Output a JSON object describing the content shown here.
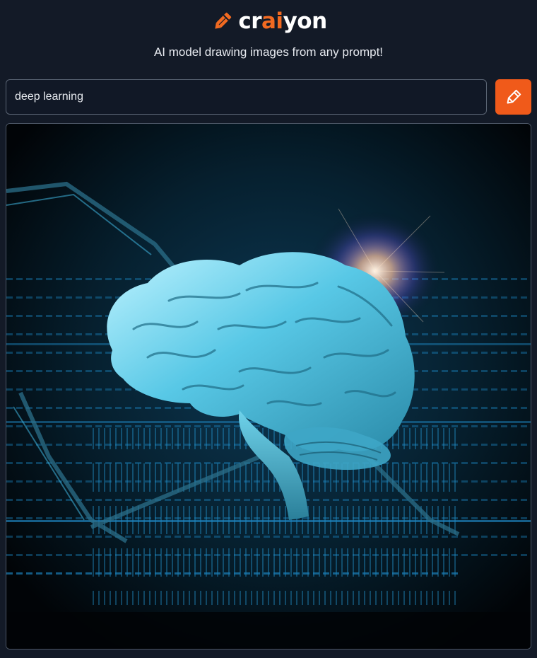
{
  "brand": {
    "logo_part1": "cr",
    "logo_part2": "ai",
    "logo_part3": "yon",
    "accent_color": "#f26a21",
    "icon": "pencil-icon"
  },
  "tagline": "AI model drawing images from any prompt!",
  "prompt": {
    "value": "deep learning"
  },
  "draw_button": {
    "icon": "pencil-icon",
    "color": "#f05a1a"
  },
  "result_image": {
    "subject": "brain-on-circuit-board"
  },
  "theme": {
    "background": "#131a27",
    "input_border": "#5a6473"
  }
}
